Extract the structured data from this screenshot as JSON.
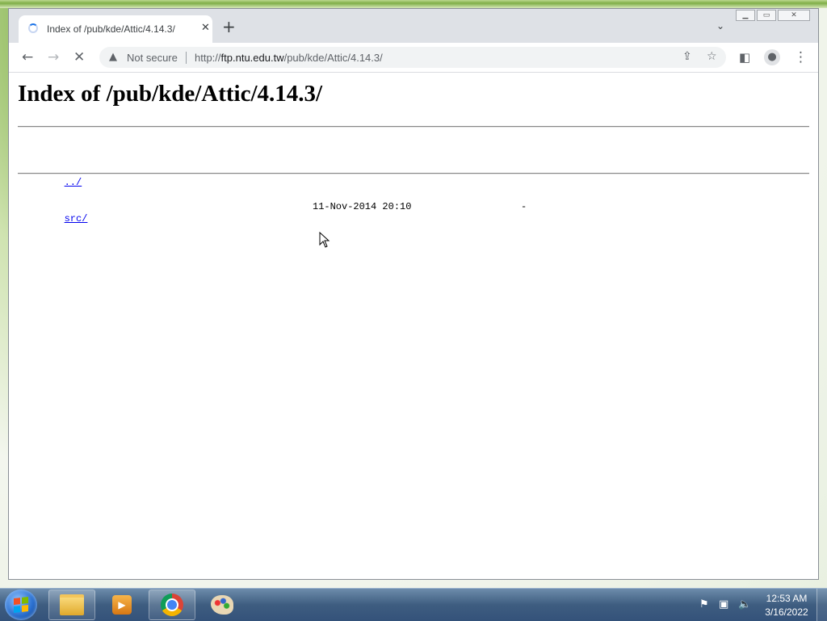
{
  "browser": {
    "tab_title": "Index of /pub/kde/Attic/4.14.3/",
    "tab_close": "✕",
    "new_tab": "+",
    "tab_dropdown": "⌄",
    "security_label": "Not secure",
    "url_prefix": "http://",
    "url_host": "ftp.ntu.edu.tw",
    "url_path": "/pub/kde/Attic/4.14.3/",
    "icons": {
      "back": "back-arrow-icon",
      "forward": "forward-arrow-icon",
      "reload": "stop-loading-icon",
      "share": "share-icon",
      "star": "bookmark-star-icon",
      "sidepanel": "side-panel-icon",
      "profile": "profile-icon",
      "menu": "more-menu-icon"
    }
  },
  "page": {
    "heading": "Index of /pub/kde/Attic/4.14.3/",
    "entries": [
      {
        "name": "../",
        "date": "",
        "size": ""
      },
      {
        "name": "src/",
        "date": "11-Nov-2014 20:10",
        "size": "-"
      }
    ]
  },
  "taskbar": {
    "apps": [
      "windows-explorer",
      "media-player",
      "google-chrome",
      "paint"
    ],
    "clock_time": "12:53 AM",
    "clock_date": "3/16/2022"
  }
}
